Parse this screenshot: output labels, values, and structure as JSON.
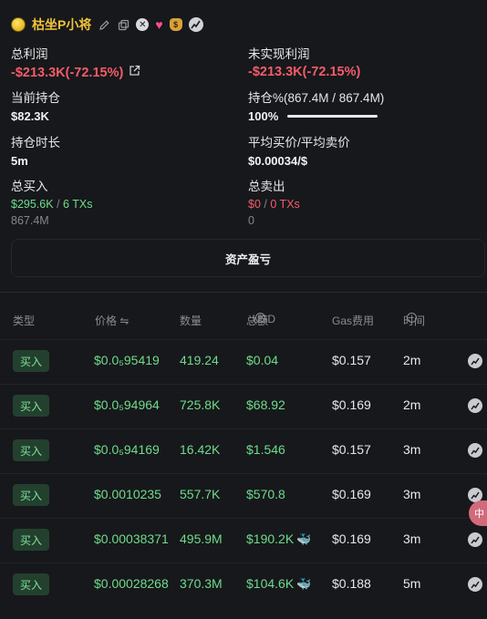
{
  "user": {
    "name": "枯坐P小将"
  },
  "stats": {
    "total_profit": {
      "label": "总利润",
      "value": "-$213.3K(-72.15%)"
    },
    "unrealized_profit": {
      "label": "未实现利润",
      "value": "-$213.3K(-72.15%)"
    },
    "current_position": {
      "label": "当前持仓",
      "value": "$82.3K"
    },
    "position_pct": {
      "label": "持仓%(867.4M / 867.4M)",
      "value": "100%",
      "progress": 1.0
    },
    "hold_duration": {
      "label": "持仓时长",
      "value": "5m"
    },
    "avg_price": {
      "label": "平均买价/平均卖价",
      "value": "$0.00034/$"
    },
    "total_buy": {
      "label": "总买入",
      "amount": "$295.6K",
      "sep": "/",
      "txs": "6 TXs",
      "qty": "867.4M"
    },
    "total_sell": {
      "label": "总卖出",
      "amount": "$0",
      "sep": "/",
      "txs": "0 TXs",
      "qty": "0"
    }
  },
  "pnl_button": "资产盈亏",
  "table": {
    "headers": {
      "type": "类型",
      "price": "价格 ⇋",
      "qty": "数量",
      "total": "总额",
      "total_unit": "USD",
      "gas": "Gas费用",
      "time": "时间"
    },
    "rows": [
      {
        "type": "买入",
        "price": "$0.0₅95419",
        "qty": "419.24",
        "total": "$0.04",
        "gas": "$0.157",
        "time": "2m",
        "whale": false
      },
      {
        "type": "买入",
        "price": "$0.0₅94964",
        "qty": "725.8K",
        "total": "$68.92",
        "gas": "$0.169",
        "time": "2m",
        "whale": false
      },
      {
        "type": "买入",
        "price": "$0.0₅94169",
        "qty": "16.42K",
        "total": "$1.546",
        "gas": "$0.157",
        "time": "3m",
        "whale": false
      },
      {
        "type": "买入",
        "price": "$0.0010235",
        "qty": "557.7K",
        "total": "$570.8",
        "gas": "$0.169",
        "time": "3m",
        "whale": false
      },
      {
        "type": "买入",
        "price": "$0.00038371",
        "qty": "495.9M",
        "total": "$190.2K",
        "gas": "$0.169",
        "time": "3m",
        "whale": true
      },
      {
        "type": "买入",
        "price": "$0.00028268",
        "qty": "370.3M",
        "total": "$104.6K",
        "gas": "$0.188",
        "time": "5m",
        "whale": true
      }
    ]
  },
  "floating_button": "中"
}
